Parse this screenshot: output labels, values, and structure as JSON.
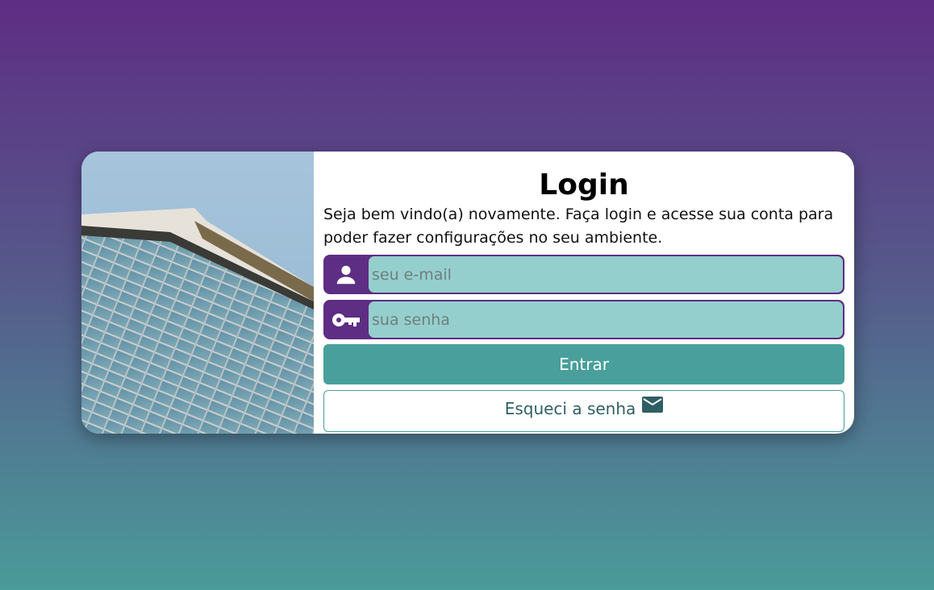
{
  "login": {
    "title": "Login",
    "subtitle": "Seja bem vindo(a) novamente. Faça login e acesse sua conta para poder fazer configurações no seu ambiente.",
    "email": {
      "placeholder": "seu e-mail",
      "value": "",
      "icon": "user-icon"
    },
    "password": {
      "placeholder": "sua senha",
      "value": "",
      "icon": "key-icon"
    },
    "submit_label": "Entrar",
    "forgot_label": "Esqueci a senha",
    "forgot_icon": "envelope-icon"
  },
  "colors": {
    "primary": "#5e2d84",
    "accent": "#489f9b",
    "input_bg": "#95cfcd"
  }
}
